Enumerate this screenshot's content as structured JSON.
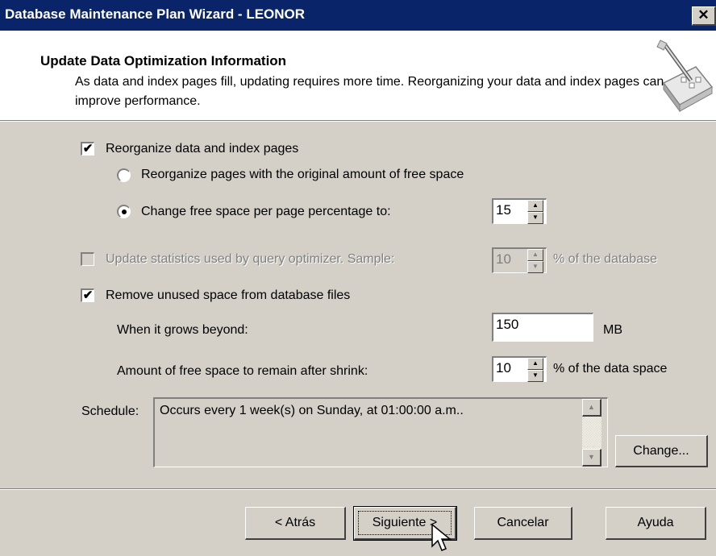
{
  "window": {
    "title": "Database Maintenance Plan Wizard - LEONOR",
    "close_glyph": "✕"
  },
  "header": {
    "title": "Update Data Optimization Information",
    "description": "As data and index pages fill, updating requires more time. Reorganizing your data and index pages can improve performance."
  },
  "options": {
    "reorganize": {
      "label": "Reorganize data and index pages",
      "checked": true
    },
    "radio_original": {
      "label": "Reorganize pages with the original amount of free space",
      "selected": false
    },
    "radio_change": {
      "label": "Change free space per page percentage to:",
      "selected": true,
      "value": "15"
    },
    "update_stats": {
      "label": "Update statistics used by query optimizer. Sample:",
      "checked": false,
      "enabled": false,
      "value": "10",
      "suffix": "% of the database"
    },
    "remove_unused": {
      "label": "Remove unused space from database files",
      "checked": true
    },
    "grows_beyond": {
      "label": "When it grows beyond:",
      "value": "150",
      "unit": "MB"
    },
    "free_after_shrink": {
      "label": "Amount of free space to remain after shrink:",
      "value": "10",
      "suffix": "% of the data space"
    }
  },
  "schedule": {
    "label": "Schedule:",
    "text": "Occurs every 1 week(s) on Sunday, at 01:00:00 a.m..",
    "change_button": "Change..."
  },
  "buttons": {
    "back": "< Atrás",
    "next": "Siguiente >",
    "cancel": "Cancelar",
    "help": "Ayuda"
  },
  "glyphs": {
    "check": "✔",
    "spin_up": "▲",
    "spin_down": "▼"
  },
  "icons": [
    "wizard-wand-icon",
    "mouse-pointer-icon"
  ]
}
